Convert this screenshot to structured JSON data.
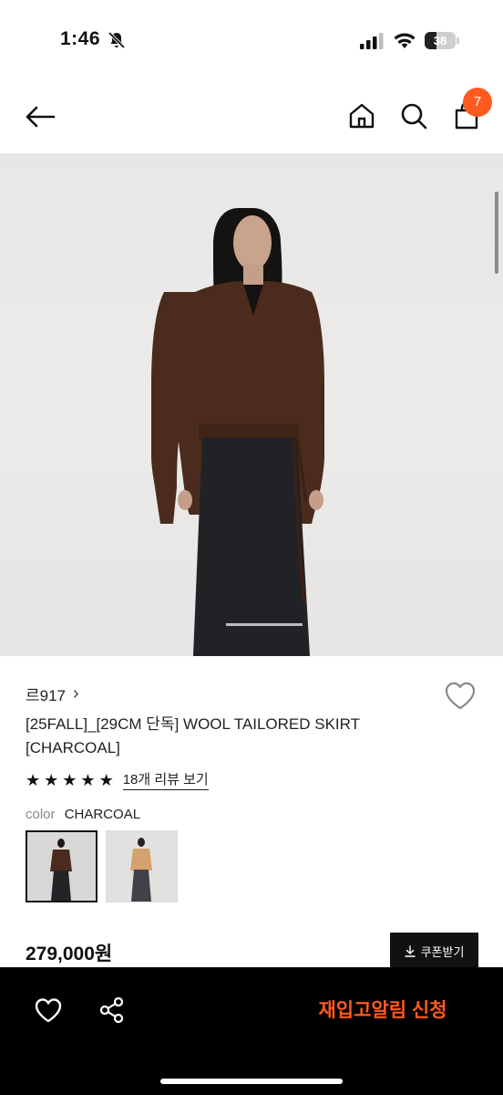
{
  "status_bar": {
    "time": "1:46",
    "battery": "38",
    "battery_level": 0.38
  },
  "nav": {
    "cart_count": "7"
  },
  "product": {
    "brand": "르917",
    "brand_chevron": "›",
    "title": "[25FALL]_[29CM 단독] WOOL TAILORED SKIRT [CHARCOAL]",
    "rating": 5,
    "review_link": "18개 리뷰 보기",
    "color_label": "color",
    "color_value": "CHARCOAL",
    "swatches": [
      "charcoal",
      "beige"
    ],
    "price": "279,000원",
    "coupon_label": "쿠폰받기",
    "image_count": 4,
    "image_current": 1
  },
  "bottom_bar": {
    "restock_label": "재입고알림 신청"
  },
  "icons": {
    "back": "arrow-left-icon",
    "home": "home-icon",
    "search": "search-icon",
    "cart": "shopping-bag-icon",
    "heart": "heart-icon",
    "share": "share-icon",
    "download": "download-icon",
    "bell_off": "bell-slash-icon"
  },
  "colors": {
    "accent": "#ff5a1f",
    "bottom_bar": "#000000"
  }
}
